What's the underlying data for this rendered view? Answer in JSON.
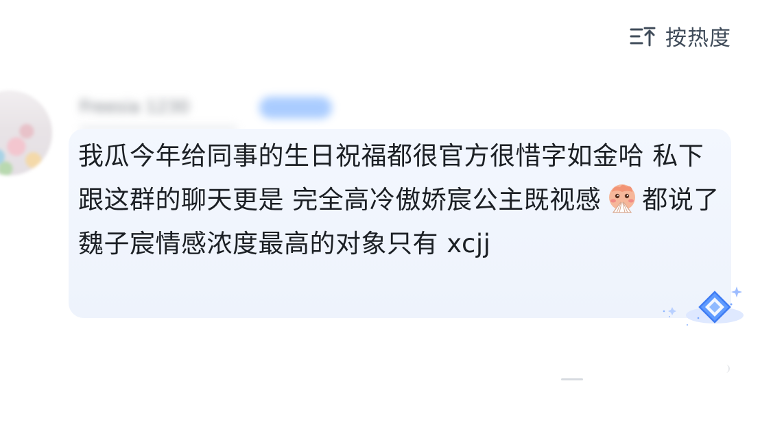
{
  "sort": {
    "label": "按热度",
    "icon": "sort-lines-icon"
  },
  "comment": {
    "username": "Freesia 1230",
    "text_part1": "我瓜今年给同事的生日祝福都很官方很惜字如金哈 私下跟这群的聊天更是 完全高冷傲娇宸公主既视感",
    "emoji": "fan-blush-emoji",
    "text_part2": "都说了魏子宸情感浓度最高的对象只有 xcjj",
    "badge_icon": "diamond-badge-icon"
  },
  "colors": {
    "background": "#ffffff",
    "bubble": "#eef3fc",
    "text": "#1b1f24",
    "sort_text": "#3f4b59",
    "badge_blue": "#4f8dff"
  }
}
